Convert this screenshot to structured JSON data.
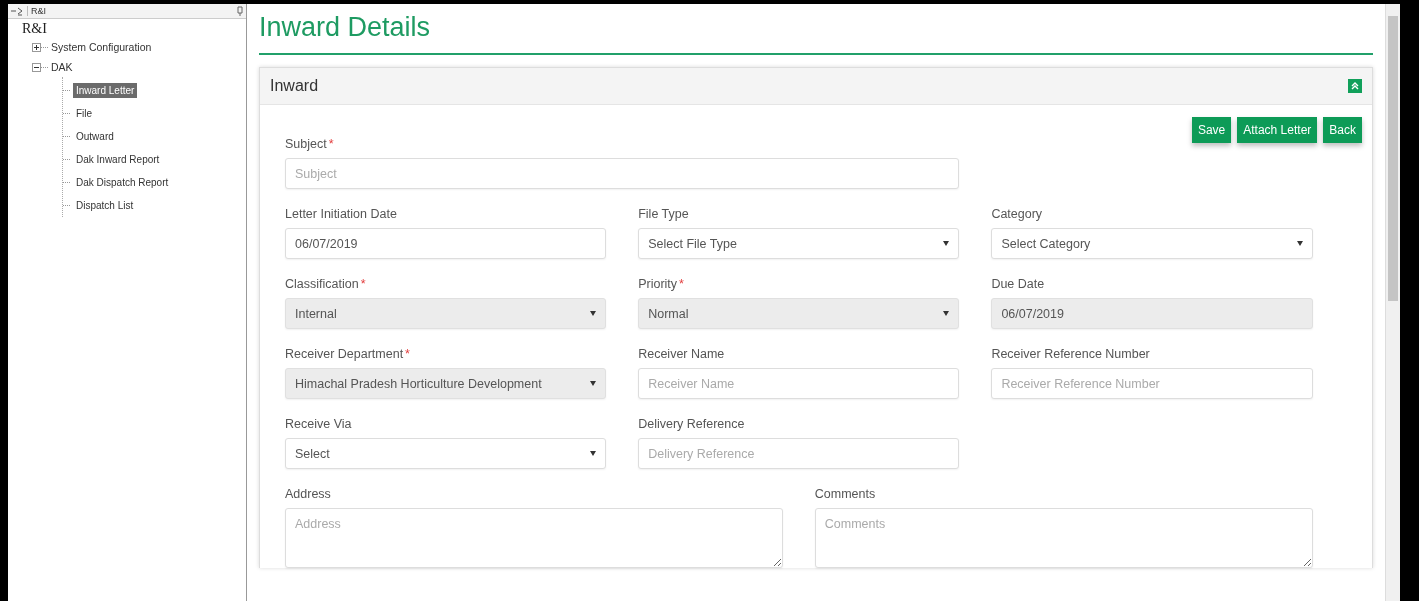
{
  "sidebar": {
    "header_title": "R&I",
    "root": "R&I",
    "items": [
      {
        "label": "System Configuration",
        "expanded": false
      },
      {
        "label": "DAK",
        "expanded": true,
        "children": [
          {
            "label": "Inward Letter",
            "selected": true
          },
          {
            "label": "File",
            "selected": false
          },
          {
            "label": "Outward",
            "selected": false
          },
          {
            "label": "Dak Inward Report",
            "selected": false
          },
          {
            "label": "Dak Dispatch Report",
            "selected": false
          },
          {
            "label": "Dispatch List",
            "selected": false
          }
        ]
      }
    ]
  },
  "page_title": "Inward Details",
  "panel": {
    "title": "Inward",
    "buttons": [
      "Save",
      "Attach Letter",
      "Back"
    ],
    "rows": [
      [
        {
          "kind": "text",
          "label": "Subject",
          "required_mark": "*",
          "placeholder": "Subject",
          "disabled": false
        }
      ],
      [
        {
          "kind": "text",
          "label": "Letter Initiation Date",
          "value": "06/07/2019",
          "disabled": false
        },
        {
          "kind": "select",
          "label": "File Type",
          "value": "Select File Type",
          "disabled": false
        },
        {
          "kind": "select",
          "label": "Category",
          "value": "Select Category",
          "disabled": false
        }
      ],
      [
        {
          "kind": "select",
          "label": "Classification",
          "required_mark": "*",
          "value": "Internal",
          "disabled": true
        },
        {
          "kind": "select",
          "label": "Priority",
          "required_mark": "*",
          "value": "Normal",
          "disabled": true
        },
        {
          "kind": "text",
          "label": "Due Date",
          "value": "06/07/2019",
          "disabled": true
        }
      ],
      [
        {
          "kind": "select",
          "label": "Receiver Department",
          "required_mark": "*",
          "value": "Himachal Pradesh Horticulture Development",
          "disabled": true
        },
        {
          "kind": "text",
          "label": "Receiver Name",
          "placeholder": "Receiver Name",
          "disabled": false
        },
        {
          "kind": "text",
          "label": "Receiver Reference Number",
          "placeholder": "Receiver Reference Number",
          "disabled": false
        }
      ],
      [
        {
          "kind": "select",
          "label": "Receive Via",
          "value": "Select",
          "disabled": false
        },
        {
          "kind": "text",
          "label": "Delivery Reference",
          "placeholder": "Delivery Reference",
          "disabled": false
        }
      ],
      [
        {
          "kind": "textarea",
          "label": "Address",
          "placeholder": "Address",
          "disabled": false
        },
        {
          "kind": "textarea",
          "label": "Comments",
          "placeholder": "Comments",
          "disabled": false
        }
      ]
    ]
  }
}
